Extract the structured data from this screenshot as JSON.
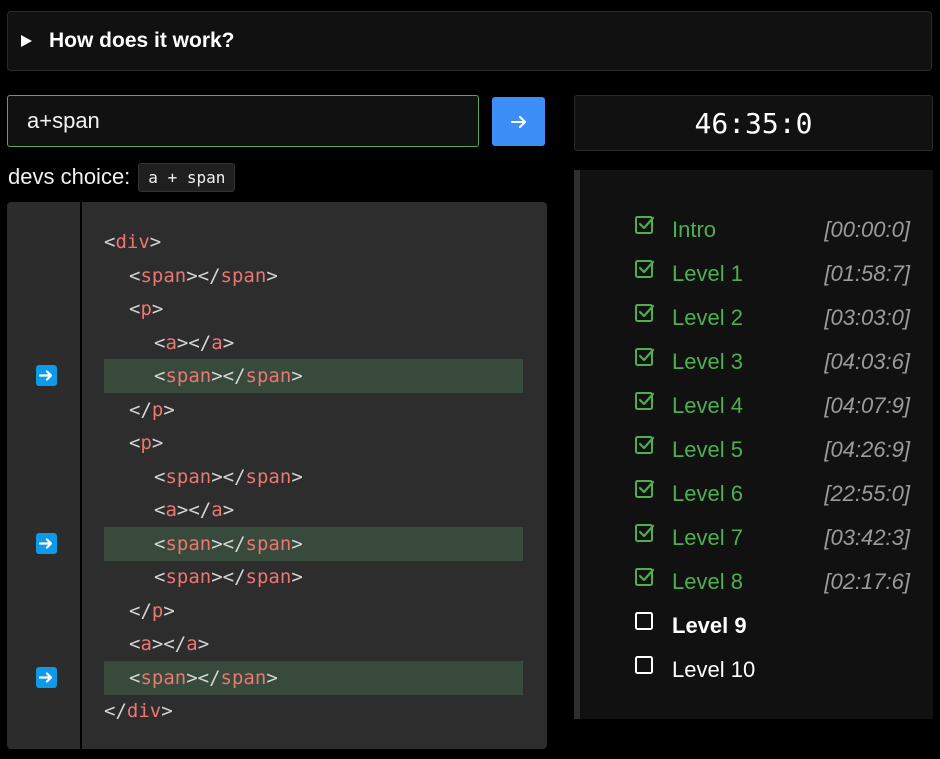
{
  "accordion": {
    "label": "How does it work?"
  },
  "selector": {
    "value": "a+span"
  },
  "devs_choice": {
    "label": "devs choice:",
    "code": "a + span"
  },
  "timer": {
    "value": "46:35:0"
  },
  "icons": {
    "submit": "arrow-right-icon",
    "gutter": "arrow-right-marker-icon",
    "checkbox": "checkbox-icon"
  },
  "colors": {
    "accent": "#3d8ef7",
    "done": "#4caf50",
    "tag": "#ec7672",
    "highlight": "#384a3b"
  },
  "code": {
    "lines": [
      {
        "indent": 0,
        "open": "div",
        "highlight": false
      },
      {
        "indent": 1,
        "tag": "span",
        "highlight": false
      },
      {
        "indent": 1,
        "open": "p",
        "highlight": false
      },
      {
        "indent": 2,
        "tag": "a",
        "highlight": false
      },
      {
        "indent": 2,
        "tag": "span",
        "highlight": true
      },
      {
        "indent": 1,
        "close": "p",
        "highlight": false
      },
      {
        "indent": 1,
        "open": "p",
        "highlight": false
      },
      {
        "indent": 2,
        "tag": "span",
        "highlight": false
      },
      {
        "indent": 2,
        "tag": "a",
        "highlight": false
      },
      {
        "indent": 2,
        "tag": "span",
        "highlight": true
      },
      {
        "indent": 2,
        "tag": "span",
        "highlight": false
      },
      {
        "indent": 1,
        "close": "p",
        "highlight": false
      },
      {
        "indent": 1,
        "tag": "a",
        "highlight": false
      },
      {
        "indent": 1,
        "tag": "span",
        "highlight": true
      },
      {
        "indent": 0,
        "close": "div",
        "highlight": false
      }
    ]
  },
  "levels": [
    {
      "name": "Intro",
      "time": "[00:00:0]",
      "status": "done"
    },
    {
      "name": "Level 1",
      "time": "[01:58:7]",
      "status": "done"
    },
    {
      "name": "Level 2",
      "time": "[03:03:0]",
      "status": "done"
    },
    {
      "name": "Level 3",
      "time": "[04:03:6]",
      "status": "done"
    },
    {
      "name": "Level 4",
      "time": "[04:07:9]",
      "status": "done"
    },
    {
      "name": "Level 5",
      "time": "[04:26:9]",
      "status": "done"
    },
    {
      "name": "Level 6",
      "time": "[22:55:0]",
      "status": "done"
    },
    {
      "name": "Level 7",
      "time": "[03:42:3]",
      "status": "done"
    },
    {
      "name": "Level 8",
      "time": "[02:17:6]",
      "status": "done"
    },
    {
      "name": "Level 9",
      "time": "",
      "status": "current"
    },
    {
      "name": "Level 10",
      "time": "",
      "status": "todo"
    }
  ]
}
